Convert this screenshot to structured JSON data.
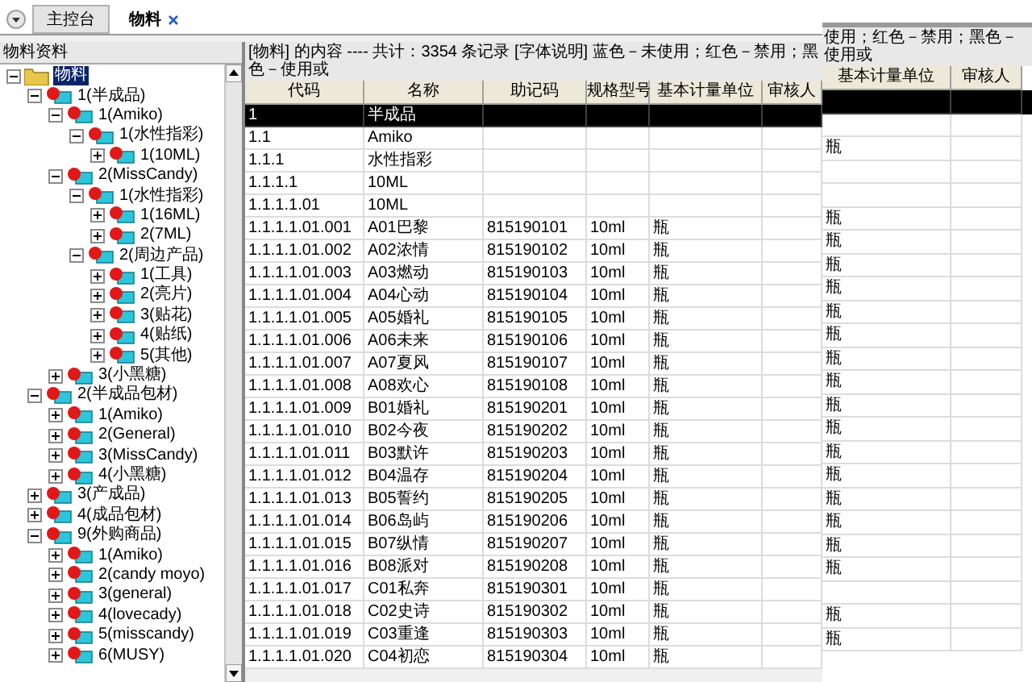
{
  "tabs": [
    {
      "label": "主控台",
      "selected": false,
      "closable": false
    },
    {
      "label": "物料",
      "selected": true,
      "closable": true
    }
  ],
  "left_panel": {
    "title": "物料资料",
    "tree": [
      {
        "label": "物料",
        "kind": "folder",
        "expanded": true,
        "selected": true,
        "children": [
          {
            "label": "1(半成品)",
            "kind": "item",
            "expanded": true,
            "selected": false,
            "children": [
              {
                "label": "1(Amiko)",
                "kind": "item",
                "expanded": true,
                "selected": false,
                "children": [
                  {
                    "label": "1(水性指彩)",
                    "kind": "item",
                    "expanded": true,
                    "selected": false,
                    "children": [
                      {
                        "label": "1(10ML)",
                        "kind": "item",
                        "expanded": false,
                        "selected": false
                      }
                    ]
                  }
                ]
              },
              {
                "label": "2(MissCandy)",
                "kind": "item",
                "expanded": true,
                "selected": false,
                "children": [
                  {
                    "label": "1(水性指彩)",
                    "kind": "item",
                    "expanded": true,
                    "selected": false,
                    "children": [
                      {
                        "label": "1(16ML)",
                        "kind": "item",
                        "expanded": false,
                        "selected": false
                      },
                      {
                        "label": "2(7ML)",
                        "kind": "item",
                        "expanded": false,
                        "selected": false
                      }
                    ]
                  },
                  {
                    "label": "2(周边产品)",
                    "kind": "item",
                    "expanded": true,
                    "selected": false,
                    "children": [
                      {
                        "label": "1(工具)",
                        "kind": "item",
                        "expanded": false,
                        "selected": false
                      },
                      {
                        "label": "2(亮片)",
                        "kind": "item",
                        "expanded": false,
                        "selected": false
                      },
                      {
                        "label": "3(贴花)",
                        "kind": "item",
                        "expanded": false,
                        "selected": false
                      },
                      {
                        "label": "4(贴纸)",
                        "kind": "item",
                        "expanded": false,
                        "selected": false
                      },
                      {
                        "label": "5(其他)",
                        "kind": "item",
                        "expanded": false,
                        "selected": false
                      }
                    ]
                  }
                ]
              },
              {
                "label": "3(小黑糖)",
                "kind": "item",
                "expanded": false,
                "selected": false
              }
            ]
          },
          {
            "label": "2(半成品包材)",
            "kind": "item",
            "expanded": true,
            "selected": false,
            "children": [
              {
                "label": "1(Amiko)",
                "kind": "item",
                "expanded": false,
                "selected": false
              },
              {
                "label": "2(General)",
                "kind": "item",
                "expanded": false,
                "selected": false
              },
              {
                "label": "3(MissCandy)",
                "kind": "item",
                "expanded": false,
                "selected": false
              },
              {
                "label": "4(小黑糖)",
                "kind": "item",
                "expanded": false,
                "selected": false
              }
            ]
          },
          {
            "label": "3(产成品)",
            "kind": "item",
            "expanded": false,
            "selected": false
          },
          {
            "label": "4(成品包材)",
            "kind": "item",
            "expanded": false,
            "selected": false
          },
          {
            "label": "9(外购商品)",
            "kind": "item",
            "expanded": true,
            "selected": false,
            "children": [
              {
                "label": "1(Amiko)",
                "kind": "item",
                "expanded": false,
                "selected": false
              },
              {
                "label": "2(candy moyo)",
                "kind": "item",
                "expanded": false,
                "selected": false
              },
              {
                "label": "3(general)",
                "kind": "item",
                "expanded": false,
                "selected": false
              },
              {
                "label": "4(lovecady)",
                "kind": "item",
                "expanded": false,
                "selected": false
              },
              {
                "label": "5(misscandy)",
                "kind": "item",
                "expanded": false,
                "selected": false
              },
              {
                "label": "6(MUSY)",
                "kind": "item",
                "expanded": false,
                "selected": false
              }
            ]
          }
        ]
      }
    ]
  },
  "main": {
    "info": "[物料] 的内容 ---- 共计：3354 条记录  [字体说明] 蓝色－未使用；红色－禁用；黑色－使用或",
    "columns": [
      "代码",
      "名称",
      "助记码",
      "规格型号",
      "基本计量单位",
      "审核人"
    ],
    "rows": [
      {
        "cells": [
          "1",
          "半成品",
          "",
          "",
          "",
          ""
        ],
        "selected": true
      },
      {
        "cells": [
          "1.1",
          "Amiko",
          "",
          "",
          "",
          ""
        ],
        "selected": false
      },
      {
        "cells": [
          "1.1.1",
          "水性指彩",
          "",
          "",
          "",
          ""
        ],
        "selected": false
      },
      {
        "cells": [
          "1.1.1.1",
          "10ML",
          "",
          "",
          "",
          ""
        ],
        "selected": false
      },
      {
        "cells": [
          "1.1.1.1.01",
          "10ML",
          "",
          "",
          "",
          ""
        ],
        "selected": false
      },
      {
        "cells": [
          "1.1.1.1.01.001",
          "A01巴黎",
          "815190101",
          "10ml",
          "瓶",
          ""
        ],
        "selected": false
      },
      {
        "cells": [
          "1.1.1.1.01.002",
          "A02浓情",
          "815190102",
          "10ml",
          "瓶",
          ""
        ],
        "selected": false
      },
      {
        "cells": [
          "1.1.1.1.01.003",
          "A03燃动",
          "815190103",
          "10ml",
          "瓶",
          ""
        ],
        "selected": false
      },
      {
        "cells": [
          "1.1.1.1.01.004",
          "A04心动",
          "815190104",
          "10ml",
          "瓶",
          ""
        ],
        "selected": false
      },
      {
        "cells": [
          "1.1.1.1.01.005",
          "A05婚礼",
          "815190105",
          "10ml",
          "瓶",
          ""
        ],
        "selected": false
      },
      {
        "cells": [
          "1.1.1.1.01.006",
          "A06未来",
          "815190106",
          "10ml",
          "瓶",
          ""
        ],
        "selected": false
      },
      {
        "cells": [
          "1.1.1.1.01.007",
          "A07夏风",
          "815190107",
          "10ml",
          "瓶",
          ""
        ],
        "selected": false
      },
      {
        "cells": [
          "1.1.1.1.01.008",
          "A08欢心",
          "815190108",
          "10ml",
          "瓶",
          ""
        ],
        "selected": false
      },
      {
        "cells": [
          "1.1.1.1.01.009",
          "B01婚礼",
          "815190201",
          "10ml",
          "瓶",
          ""
        ],
        "selected": false
      },
      {
        "cells": [
          "1.1.1.1.01.010",
          "B02今夜",
          "815190202",
          "10ml",
          "瓶",
          ""
        ],
        "selected": false
      },
      {
        "cells": [
          "1.1.1.1.01.011",
          "B03默许",
          "815190203",
          "10ml",
          "瓶",
          ""
        ],
        "selected": false
      },
      {
        "cells": [
          "1.1.1.1.01.012",
          "B04温存",
          "815190204",
          "10ml",
          "瓶",
          ""
        ],
        "selected": false
      },
      {
        "cells": [
          "1.1.1.1.01.013",
          "B05誓约",
          "815190205",
          "10ml",
          "瓶",
          ""
        ],
        "selected": false
      },
      {
        "cells": [
          "1.1.1.1.01.014",
          "B06岛屿",
          "815190206",
          "10ml",
          "瓶",
          ""
        ],
        "selected": false
      },
      {
        "cells": [
          "1.1.1.1.01.015",
          "B07纵情",
          "815190207",
          "10ml",
          "瓶",
          ""
        ],
        "selected": false
      },
      {
        "cells": [
          "1.1.1.1.01.016",
          "B08派对",
          "815190208",
          "10ml",
          "瓶",
          ""
        ],
        "selected": false
      },
      {
        "cells": [
          "1.1.1.1.01.017",
          "C01私奔",
          "815190301",
          "10ml",
          "瓶",
          ""
        ],
        "selected": false
      },
      {
        "cells": [
          "1.1.1.1.01.018",
          "C02史诗",
          "815190302",
          "10ml",
          "瓶",
          ""
        ],
        "selected": false
      },
      {
        "cells": [
          "1.1.1.1.01.019",
          "C03重逢",
          "815190303",
          "10ml",
          "瓶",
          ""
        ],
        "selected": false
      },
      {
        "cells": [
          "1.1.1.1.01.020",
          "C04初恋",
          "815190304",
          "10ml",
          "瓶",
          ""
        ],
        "selected": false
      }
    ]
  },
  "overlay": {
    "info": "使用；红色－禁用；黑色－使用或",
    "columns": [
      "基本计量单位",
      "审核人"
    ],
    "rows": [
      {
        "cells": [
          "",
          ""
        ],
        "selected": true
      },
      {
        "cells": [
          "",
          ""
        ],
        "selected": false
      },
      {
        "cells": [
          "瓶",
          ""
        ],
        "selected": false
      },
      {
        "cells": [
          "",
          ""
        ],
        "selected": false
      },
      {
        "cells": [
          "",
          ""
        ],
        "selected": false
      },
      {
        "cells": [
          "瓶",
          ""
        ],
        "selected": false
      },
      {
        "cells": [
          "瓶",
          ""
        ],
        "selected": false
      },
      {
        "cells": [
          "瓶",
          ""
        ],
        "selected": false
      },
      {
        "cells": [
          "瓶",
          ""
        ],
        "selected": false
      },
      {
        "cells": [
          "瓶",
          ""
        ],
        "selected": false
      },
      {
        "cells": [
          "瓶",
          ""
        ],
        "selected": false
      },
      {
        "cells": [
          "瓶",
          ""
        ],
        "selected": false
      },
      {
        "cells": [
          "瓶",
          ""
        ],
        "selected": false
      },
      {
        "cells": [
          "瓶",
          ""
        ],
        "selected": false
      },
      {
        "cells": [
          "瓶",
          ""
        ],
        "selected": false
      },
      {
        "cells": [
          "瓶",
          ""
        ],
        "selected": false
      },
      {
        "cells": [
          "瓶",
          ""
        ],
        "selected": false
      },
      {
        "cells": [
          "瓶",
          ""
        ],
        "selected": false
      },
      {
        "cells": [
          "瓶",
          ""
        ],
        "selected": false
      },
      {
        "cells": [
          "瓶",
          ""
        ],
        "selected": false
      },
      {
        "cells": [
          "瓶",
          ""
        ],
        "selected": false
      },
      {
        "cells": [
          "",
          ""
        ],
        "selected": false
      },
      {
        "cells": [
          "瓶",
          ""
        ],
        "selected": false
      },
      {
        "cells": [
          "瓶",
          ""
        ],
        "selected": false
      }
    ]
  }
}
